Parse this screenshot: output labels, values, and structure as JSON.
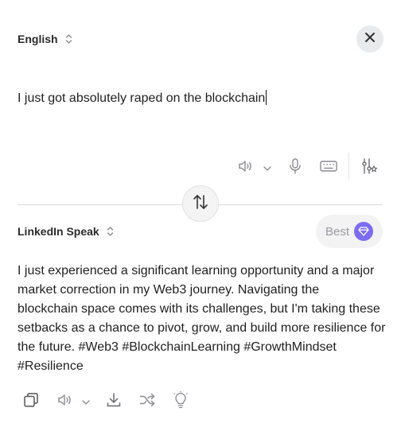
{
  "source": {
    "language": "English",
    "text": "I just got absolutely raped on the blockchain"
  },
  "target": {
    "style": "LinkedIn Speak",
    "quality_label": "Best",
    "lines": [
      "I just experienced a significant learning opportunity and a major",
      "market correction in my Web3 journey. Navigating the",
      "blockchain space comes with its challenges, but I'm taking these",
      "setbacks as a chance to pivot, grow, and build more resilience for",
      "the future. #Web3 #BlockchainLearning #GrowthMindset",
      "#Resilience"
    ]
  },
  "colors": {
    "accent": "#7b6cf0",
    "icon": "#8a8a92",
    "text": "#1f1f1f"
  },
  "icons": {
    "top_toolbar": [
      "speaker-icon",
      "chevron-down-icon",
      "microphone-icon",
      "keyboard-icon",
      "sliders-settings-icon"
    ],
    "bottom_toolbar": [
      "copy-icon",
      "speaker-icon",
      "chevron-down-icon",
      "download-icon",
      "shuffle-icon",
      "lightbulb-icon"
    ]
  }
}
